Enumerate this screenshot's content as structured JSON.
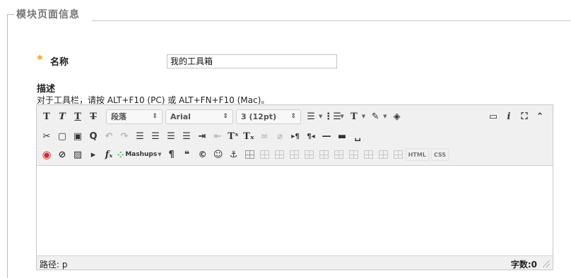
{
  "section": {
    "title": "模块页面信息"
  },
  "name_field": {
    "required_mark": "*",
    "label": "名称",
    "value": "我的工具箱"
  },
  "description": {
    "label": "描述",
    "hint": "对于工具栏，请按 ALT+F10 (PC) 或 ALT+FN+F10 (Mac)。"
  },
  "toolbar": {
    "format_select": "段落",
    "font_select": "Arial",
    "size_select": "3 (12pt)",
    "mashups_label": "Mashups",
    "html_label": "HTML",
    "css_label": "CSS"
  },
  "status": {
    "path": "路径: p",
    "count": "字数:0"
  }
}
